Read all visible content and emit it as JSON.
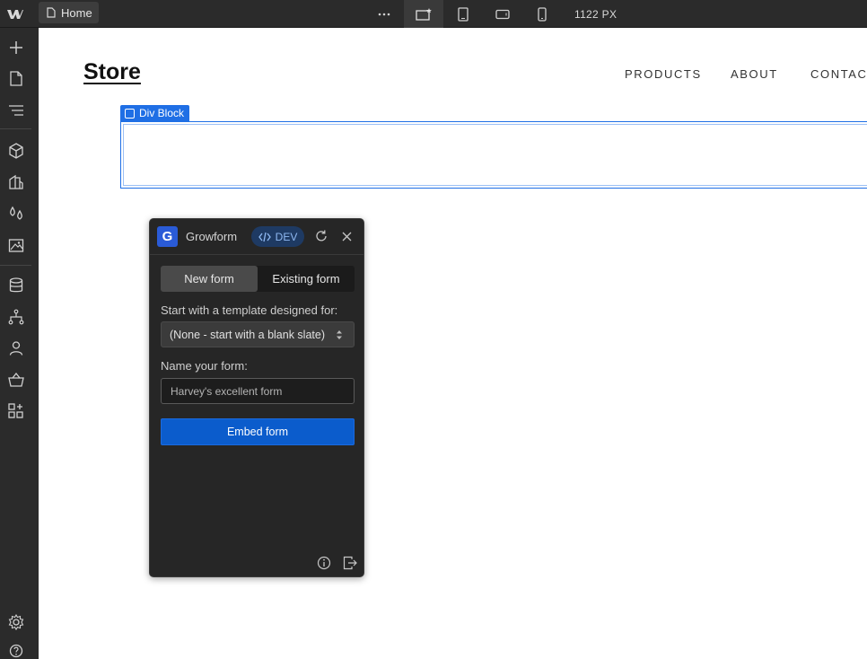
{
  "topbar": {
    "page_tab": "Home",
    "more_icon": "ellipsis-icon",
    "breakpoints": [
      "desktop-star-icon",
      "tablet-icon",
      "mobile-landscape-icon",
      "mobile-portrait-icon"
    ],
    "width_readout": "1122 PX"
  },
  "sidebar": {
    "items": [
      "add-icon",
      "pages-icon",
      "navigator-icon",
      "components-icon",
      "style-selector-icon",
      "variables-icon",
      "assets-icon",
      "cms-icon",
      "logic-icon",
      "users-icon",
      "ecommerce-icon",
      "apps-icon"
    ],
    "bottom_items": [
      "settings-icon",
      "help-icon"
    ]
  },
  "page": {
    "brand": "Store",
    "nav": [
      "PRODUCTS",
      "ABOUT",
      "CONTACT"
    ],
    "selected_element": "Div Block"
  },
  "growform": {
    "logo_letter": "G",
    "title": "Growform",
    "badge": "DEV",
    "tabs": [
      "New form",
      "Existing form"
    ],
    "active_tab": "New form",
    "template_label": "Start with a template designed for:",
    "template_value": "(None - start with a blank slate)",
    "name_label": "Name your form:",
    "name_value": "Harvey's excellent form",
    "embed_button": "Embed form"
  },
  "colors": {
    "chrome": "#2b2b2b",
    "accent": "#1f6fe5",
    "embed": "#0b5ccc"
  }
}
